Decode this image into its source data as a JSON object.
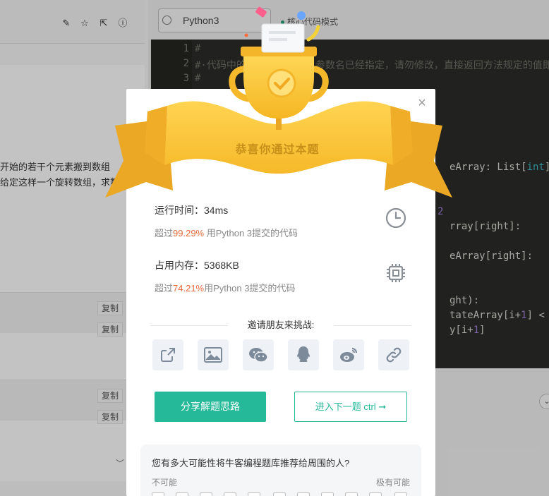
{
  "background": {
    "left_panel": {
      "problem_line_1": "开始的若干个元素搬到数组",
      "problem_line_2": "给定这样一个旋转数组，求数",
      "copy_label": "复制"
    },
    "editor": {
      "language": "Python3",
      "core_mode": "核心代码模式",
      "line_numbers": [
        "1",
        "2",
        "3"
      ],
      "line_1": "#",
      "line_2": "#·代码中的类名、方法名、参数名已经指定，请勿修改，直接返回方法规定的值即可",
      "line_3": "#",
      "code_fragments": {
        "a_pre": "eArray: List[",
        "a_kw": "int",
        "a_post": "]",
        "b": "2",
        "c": "rray[right]:",
        "d": "eArray[right]:",
        "e": "ght):",
        "f_pre": "tateArray[i+",
        "f_num": "1",
        "f_post": "] < ro",
        "g_pre": "y[i+",
        "g_num": "1",
        "g_post": "]"
      }
    }
  },
  "modal": {
    "banner_title": "恭喜你通过本题",
    "runtime": {
      "label": "运行时间：34ms",
      "sub_prefix": "超过",
      "percent": "99.29%",
      "sub_suffix": " 用Python 3提交的代码"
    },
    "memory": {
      "label": "占用内存：5368KB",
      "sub_prefix": "超过",
      "percent": "74.21%",
      "sub_suffix": "用Python 3提交的代码"
    },
    "invite_title": "邀请朋友来挑战:",
    "share_icons": [
      "share-out-icon",
      "image-icon",
      "wechat-icon",
      "qq-icon",
      "weibo-icon",
      "link-icon"
    ],
    "share_button": "分享解题思路",
    "next_button": "进入下一题 ctrl",
    "survey": {
      "question": "您有多大可能性将牛客编程题库推荐给周围的人?",
      "low_label": "不可能",
      "high_label": "极有可能"
    }
  },
  "colors": {
    "accent_green": "#25b899",
    "percent_orange": "#e8693b",
    "banner_gold": "#f7c23a",
    "banner_text": "#c8901a"
  }
}
